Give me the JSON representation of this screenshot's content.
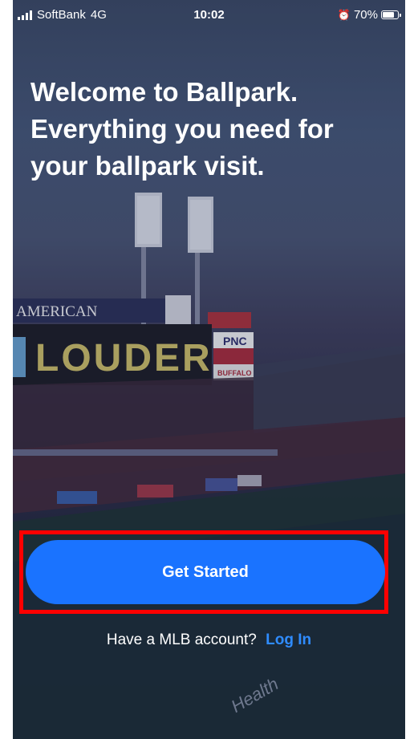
{
  "status_bar": {
    "carrier": "SoftBank",
    "network": "4G",
    "time": "10:02",
    "battery_percent": "70%",
    "battery_level": 0.7,
    "icons": [
      "signal-icon",
      "alarm-icon",
      "battery-icon"
    ]
  },
  "welcome": {
    "lines": [
      "Welcome to Ballpark.",
      "Everything you need for",
      "your ballpark visit."
    ]
  },
  "background": {
    "scoreboard_text": "LOUDER",
    "banner_text": "AMERICAN",
    "sponsor_pnc": "PNC",
    "sponsor_buffalo": "BUFFALO",
    "field_text": "Health"
  },
  "cta": {
    "get_started_label": "Get Started",
    "button_color": "#1a73ff",
    "highlight_color": "#ff0000"
  },
  "login": {
    "prompt": "Have a MLB account?",
    "link_label": "Log In",
    "link_color": "#2f8cff"
  }
}
